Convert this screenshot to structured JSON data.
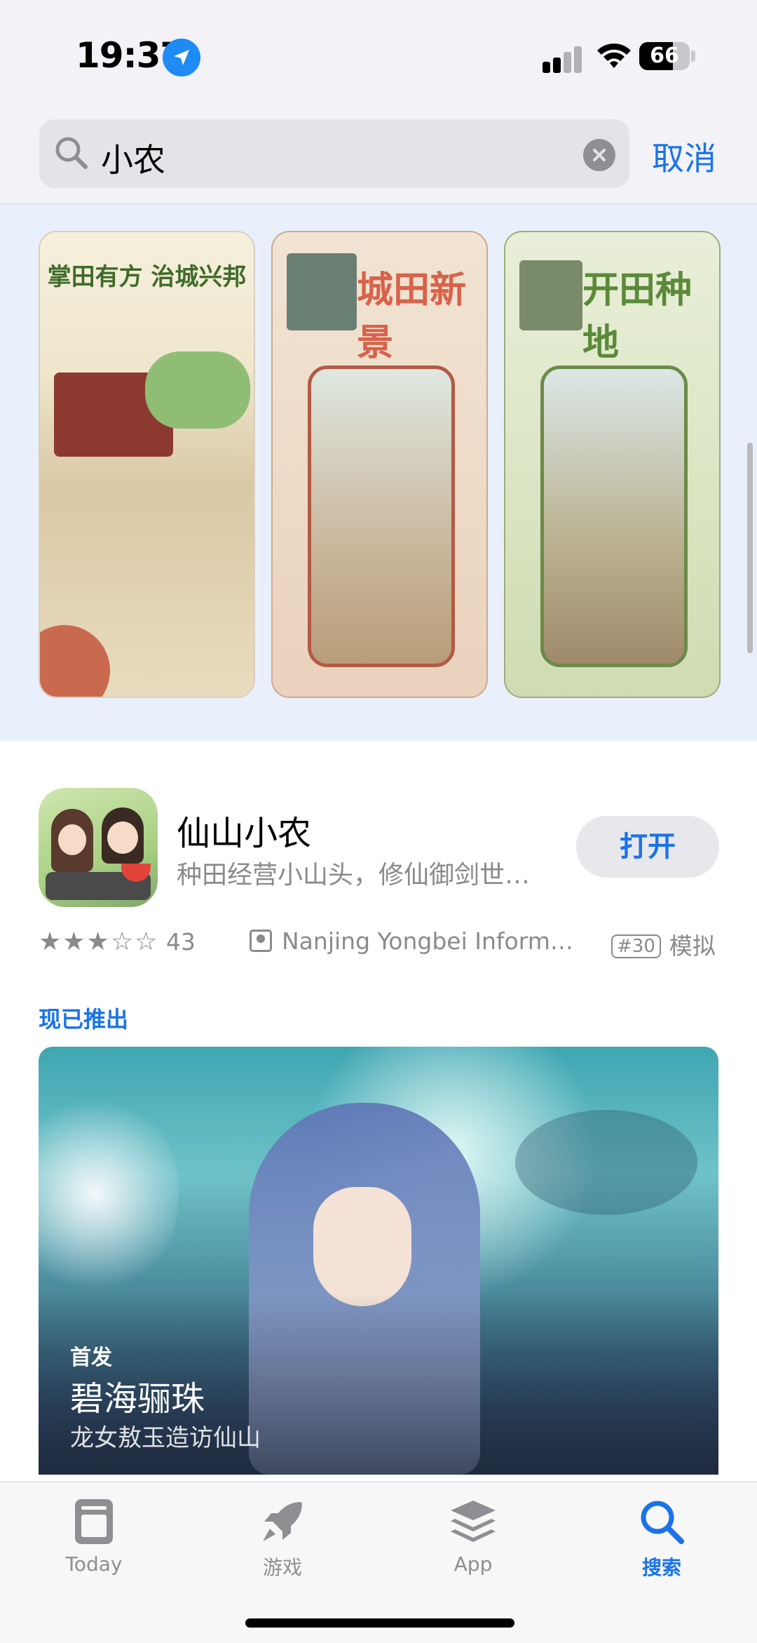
{
  "status_bar": {
    "time": "19:37",
    "battery": "66",
    "battery_level": 0.66
  },
  "search": {
    "query": "小农",
    "cancel_label": "取消"
  },
  "screenshots": [
    {
      "caption": "掌田有方 治城兴邦"
    },
    {
      "caption": "城田新景"
    },
    {
      "caption": "开田种地"
    }
  ],
  "app": {
    "name": "仙山小农",
    "subtitle": "种田经营小山头，修仙御剑世…",
    "open_label": "打开",
    "rating": 3.5,
    "rating_stars": "★★★☆☆",
    "rating_count": "43",
    "developer": "Nanjing Yongbei Inform…",
    "rank": "#30",
    "category": "模拟"
  },
  "now_available": {
    "label": "现已推出",
    "card": {
      "tag": "首发",
      "title": "碧海骊珠",
      "subtitle": "龙女敖玉造访仙山"
    }
  },
  "tabbar": {
    "tabs": [
      {
        "label": "Today",
        "icon": "today-icon"
      },
      {
        "label": "游戏",
        "icon": "rocket-icon"
      },
      {
        "label": "App",
        "icon": "apps-stack-icon"
      },
      {
        "label": "搜索",
        "icon": "search-icon",
        "active": true
      }
    ]
  },
  "colors": {
    "accent": "#1a73e8",
    "secondary_text": "#8a8a8e",
    "header_bg": "#f2f2f7"
  }
}
